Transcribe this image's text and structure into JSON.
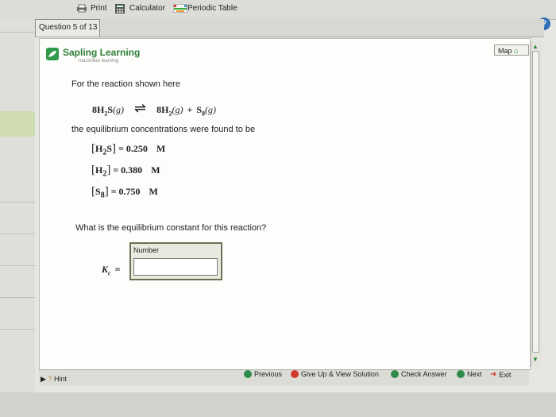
{
  "toolbar": {
    "print": "Print",
    "calculator": "Calculator",
    "periodic_table": "Periodic Table"
  },
  "question_tab": "Question 5 of 13",
  "logo": {
    "name": "Sapling Learning",
    "sub": "macmillan learning"
  },
  "map_button": "Map",
  "prompt": "For the reaction shown here",
  "reaction": {
    "lhs_coef": "8",
    "lhs_species": "H",
    "lhs_sub": "2",
    "lhs_tail": "S",
    "lhs_phase": "(g)",
    "arrow": "⇌",
    "rhs1_coef": "8",
    "rhs1_species": "H",
    "rhs1_sub": "2",
    "rhs1_phase": "(g)",
    "plus": "+",
    "rhs2_species": "S",
    "rhs2_sub": "8",
    "rhs2_phase": "(g)"
  },
  "equilibrium_text": "the equilibrium concentrations were found to be",
  "concentrations": [
    {
      "species": "H",
      "sub": "2",
      "tail": "S",
      "value": "= 0.250",
      "unit": "M"
    },
    {
      "species": "H",
      "sub": "2",
      "tail": "",
      "value": "= 0.380",
      "unit": "M"
    },
    {
      "species": "S",
      "sub": "8",
      "tail": "",
      "value": "= 0.750",
      "unit": "M"
    }
  ],
  "question": "What is the equilibrium constant for this reaction?",
  "answer": {
    "label": "Number",
    "kc_symbol": "K",
    "kc_sub": "c",
    "equals": "=",
    "value": ""
  },
  "bottom": {
    "hint": "Hint",
    "previous": "Previous",
    "give_up": "Give Up & View Solution",
    "check": "Check Answer",
    "next": "Next",
    "exit": "Exit"
  },
  "help_icon": "?",
  "colors": {
    "brand_green": "#2f9b4a",
    "help_blue": "#2f6fb5",
    "give_up_red": "#d23a2a"
  }
}
